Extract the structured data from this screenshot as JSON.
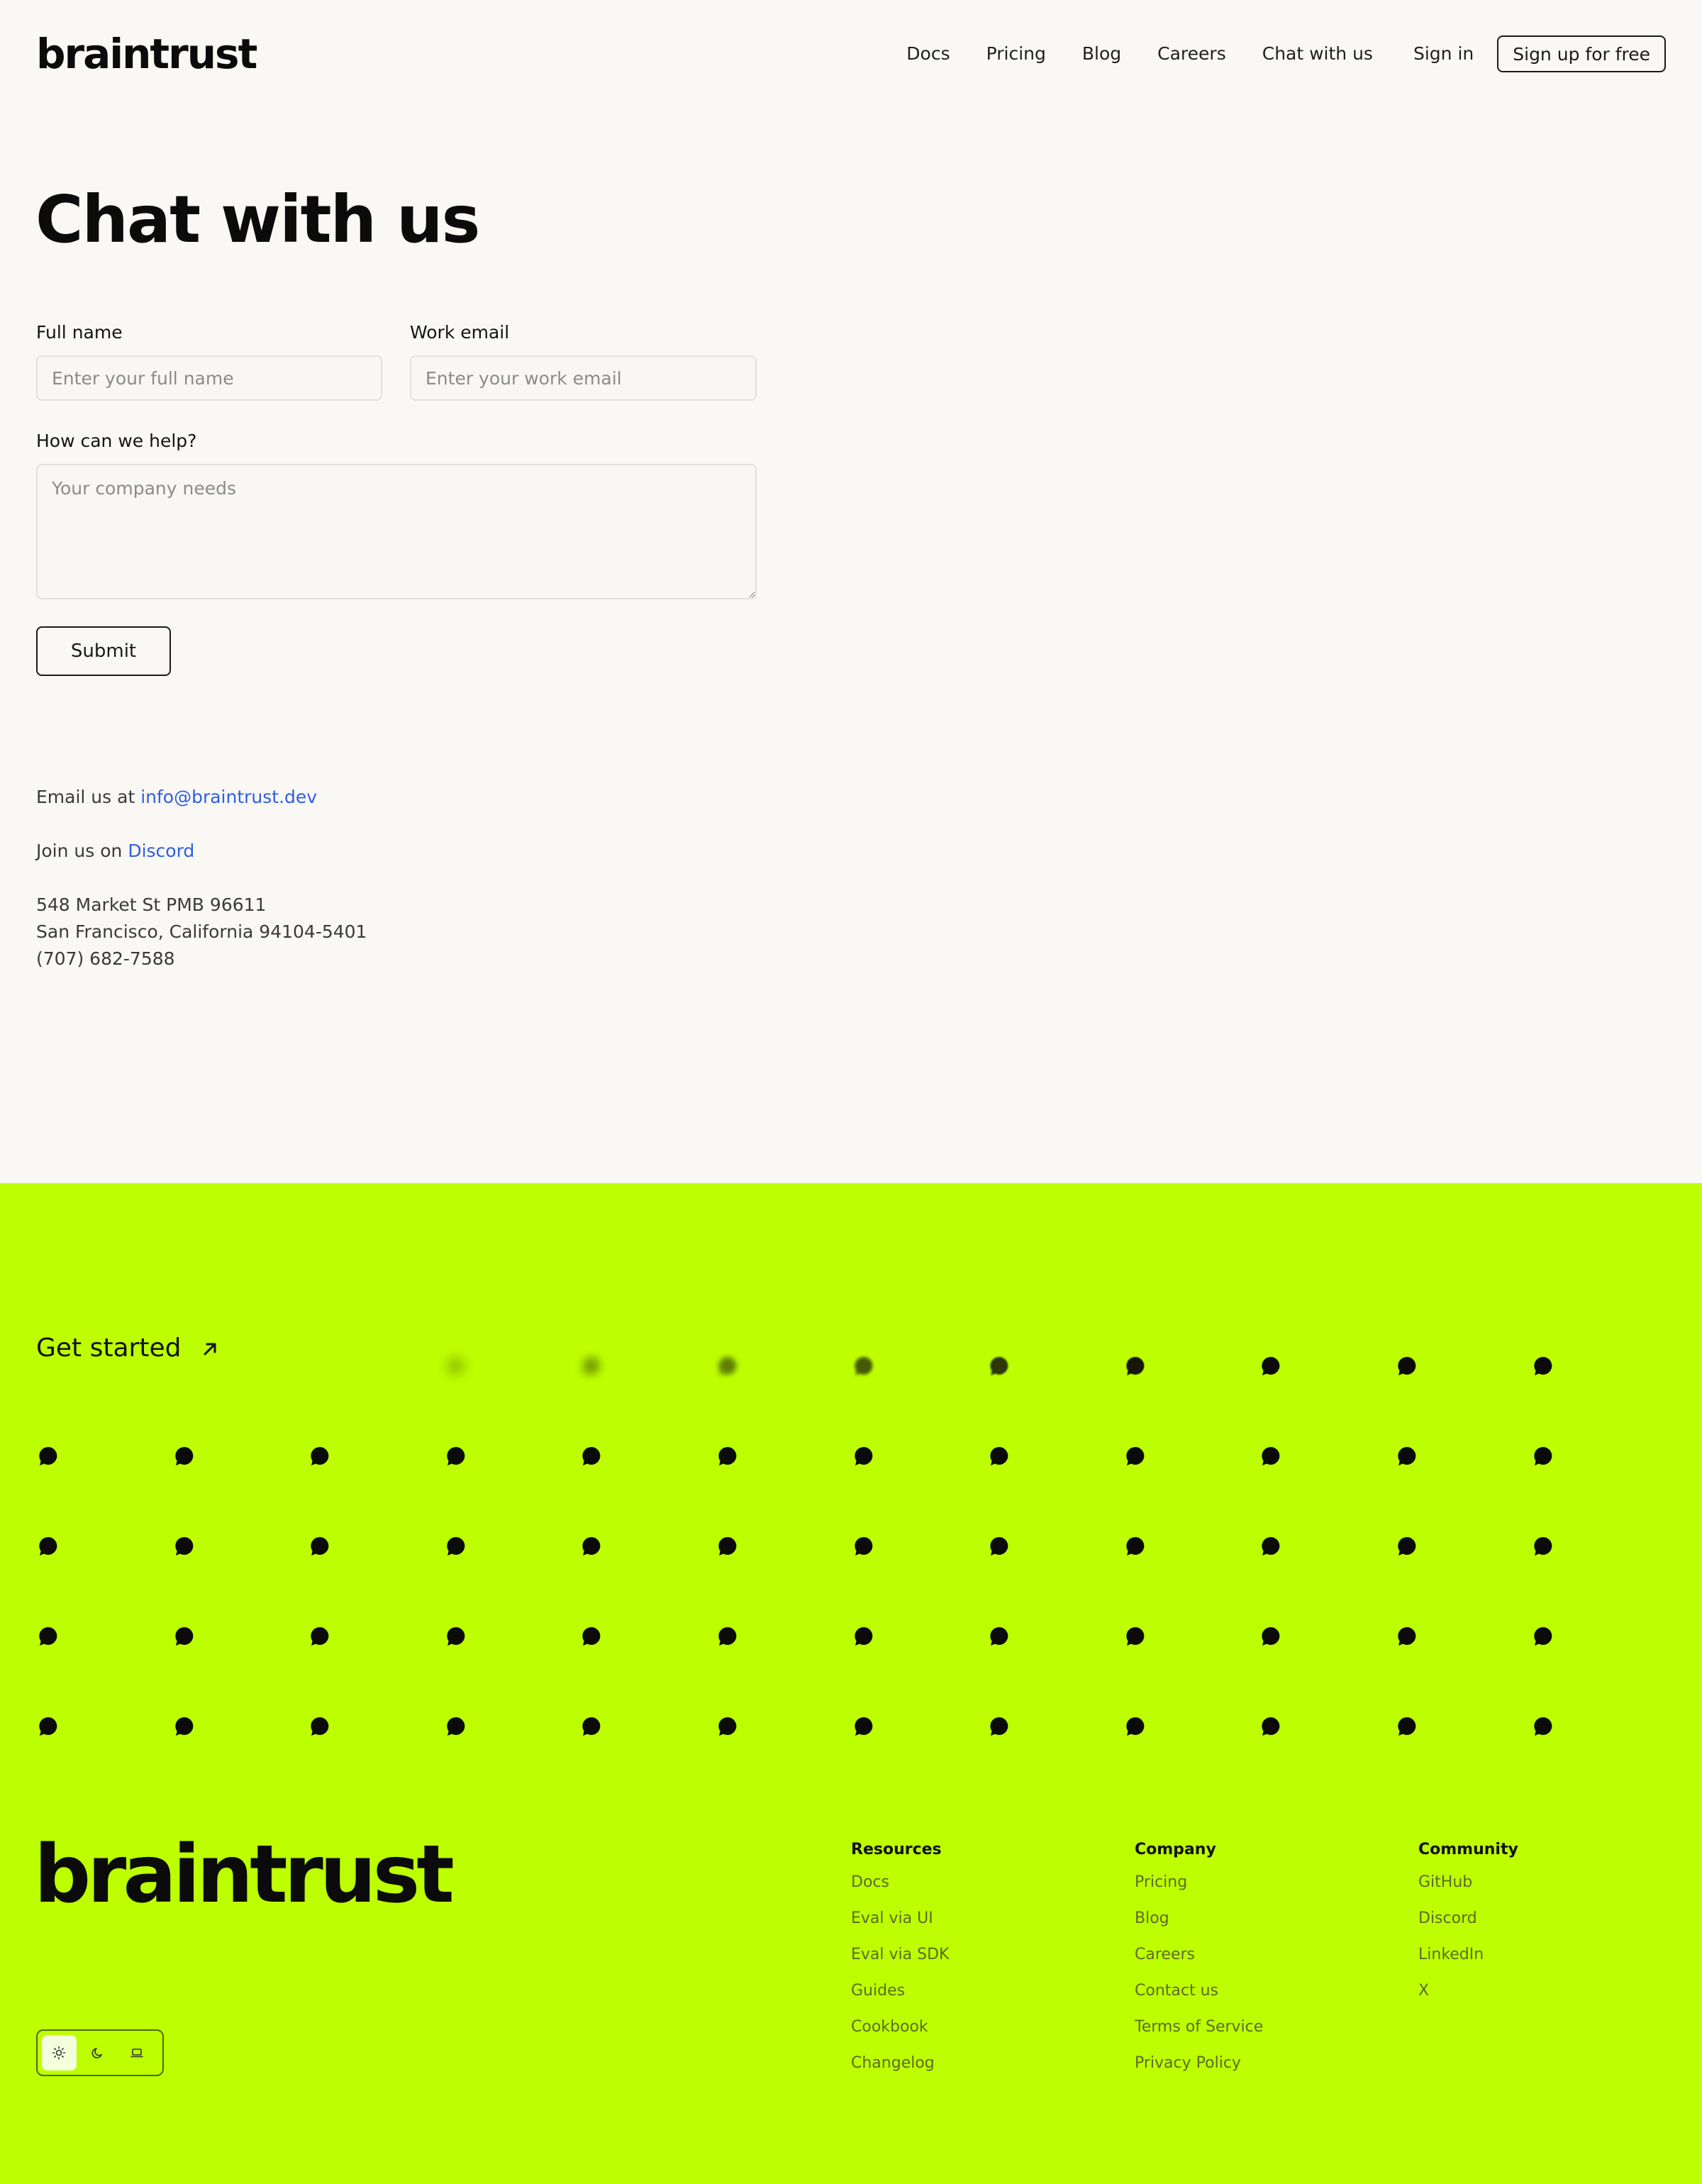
{
  "header": {
    "logo": "braintrust",
    "nav": [
      {
        "label": "Docs"
      },
      {
        "label": "Pricing"
      },
      {
        "label": "Blog"
      },
      {
        "label": "Careers"
      },
      {
        "label": "Chat with us"
      },
      {
        "label": "Sign in"
      }
    ],
    "signup_label": "Sign up for free"
  },
  "page": {
    "title": "Chat with us"
  },
  "form": {
    "full_name_label": "Full name",
    "full_name_placeholder": "Enter your full name",
    "work_email_label": "Work email",
    "work_email_placeholder": "Enter your work email",
    "help_label": "How can we help?",
    "help_placeholder": "Your company needs",
    "submit_label": "Submit"
  },
  "contact": {
    "email_prefix": "Email us at",
    "email": "info@braintrust.dev",
    "discord_prefix": "Join us on",
    "discord": "Discord",
    "address_line1": "548 Market St PMB 96611",
    "address_line2": "San Francisco, California 94104-5401",
    "phone": "(707) 682-7588"
  },
  "footer": {
    "get_started": "Get started",
    "logo": "braintrust",
    "columns": [
      {
        "heading": "Resources",
        "links": [
          "Docs",
          "Eval via UI",
          "Eval via SDK",
          "Guides",
          "Cookbook",
          "Changelog"
        ]
      },
      {
        "heading": "Company",
        "links": [
          "Pricing",
          "Blog",
          "Careers",
          "Contact us",
          "Terms of Service",
          "Privacy Policy"
        ]
      },
      {
        "heading": "Community",
        "links": [
          "GitHub",
          "Discord",
          "LinkedIn",
          "X"
        ]
      }
    ],
    "theme_options": [
      "sun-icon",
      "moon-icon",
      "laptop-icon"
    ],
    "theme_active": "sun-icon"
  },
  "colors": {
    "background": "#f9f8f5",
    "footer_background": "#bdff00",
    "link": "#2f5fe0",
    "text": "#121212"
  }
}
